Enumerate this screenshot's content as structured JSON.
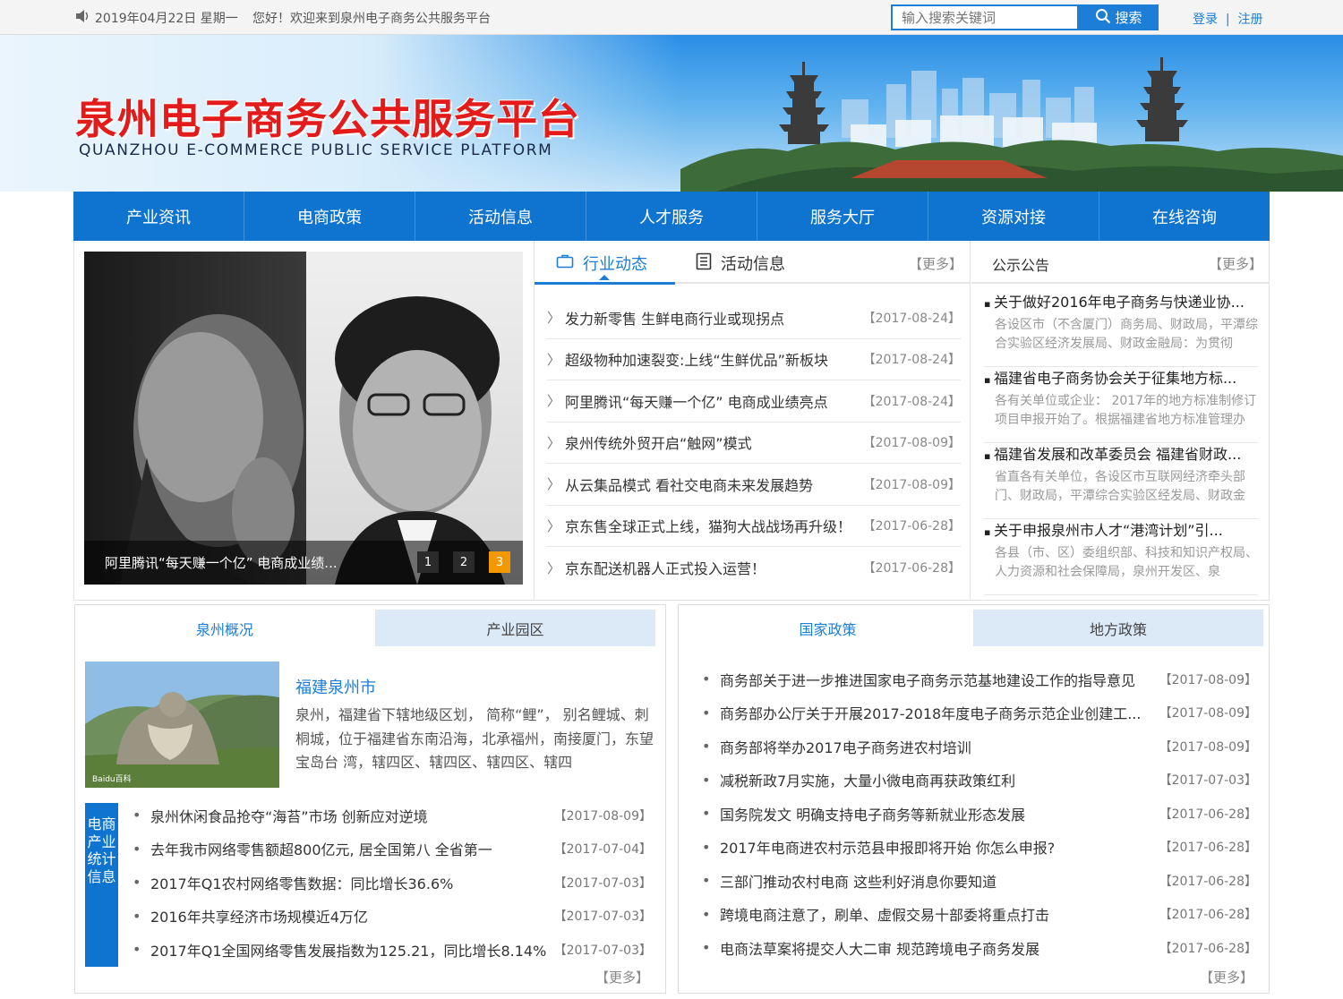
{
  "topbar": {
    "date": "2019年04月22日 星期一",
    "welcome": "您好！欢迎来到泉州电子商务公共服务平台",
    "search_placeholder": "输入搜索关键词",
    "search_label": "搜索",
    "login": "登录",
    "sep": "|",
    "register": "注册"
  },
  "banner": {
    "title": "泉州电子商务公共服务平台",
    "subtitle": "QUANZHOU E-COMMERCE PUBLIC SERVICE PLATFORM"
  },
  "nav": [
    "产业资讯",
    "电商政策",
    "活动信息",
    "人才服务",
    "服务大厅",
    "资源对接",
    "在线咨询"
  ],
  "slider": {
    "caption": "阿里腾讯“每天赚一个亿” 电商成业绩...",
    "pages": [
      "1",
      "2",
      "3"
    ],
    "active_page": 3
  },
  "news": {
    "tab_active": "行业动态",
    "tab_other": "活动信息",
    "more": "【更多】",
    "items": [
      {
        "title": "发力新零售 生鲜电商行业或现拐点",
        "date": "【2017-08-24】"
      },
      {
        "title": "超级物种加速裂变:上线“生鲜优品”新板块",
        "date": "【2017-08-24】"
      },
      {
        "title": "阿里腾讯“每天赚一个亿” 电商成业绩亮点",
        "date": "【2017-08-24】"
      },
      {
        "title": "泉州传统外贸开启“触网”模式",
        "date": "【2017-08-09】"
      },
      {
        "title": "从云集品模式 看社交电商未来发展趋势",
        "date": "【2017-08-09】"
      },
      {
        "title": "京东售全球正式上线，猫狗大战战场再升级！",
        "date": "【2017-06-28】"
      },
      {
        "title": "京东配送机器人正式投入运营！",
        "date": "【2017-06-28】"
      }
    ]
  },
  "notices": {
    "title": "公示公告",
    "more": "【更多】",
    "items": [
      {
        "title": "关于做好2016年电子商务与快递业协...",
        "desc": "各设区市（不含厦门）商务局、财政局，平潭综合实验区经济发展局、财政金融局：为贯彻"
      },
      {
        "title": "福建省电子商务协会关于征集地方标...",
        "desc": "各有关单位或企业： 2017年的地方标准制修订项目申报开始了。根据福建省地方标准管理办"
      },
      {
        "title": "福建省发展和改革委员会 福建省财政...",
        "desc": "省直各有关单位，各设区市互联网经济牵头部门、财政局，平潭综合实验区经发局、财政金"
      },
      {
        "title": "关于申报泉州市人才“港湾计划”引...",
        "desc": "各县（市、区）委组织部、科技和知识产权局、人力资源和社会保障局，泉州开发区、泉"
      }
    ]
  },
  "overview": {
    "tab_active": "泉州概况",
    "tab_other": "产业园区",
    "city_title": "福建泉州市",
    "city_desc": "泉州，福建省下辖地级区划， 简称“鲤”， 别名鲤城、刺桐城，位于福建省东南沿海，北承福州，南接厦门，东望宝岛台 湾，辖四区、辖四区、辖四区、辖四",
    "image_watermark": "Baidu百科",
    "stat_tag": "电商产业统计信息",
    "more": "【更多】",
    "stats": [
      {
        "title": "泉州休闲食品抢夺“海苔”市场 创新应对逆境",
        "date": "【2017-08-09】"
      },
      {
        "title": "去年我市网络零售额超800亿元, 居全国第八 全省第一",
        "date": "【2017-07-04】"
      },
      {
        "title": "2017年Q1农村网络零售数据：同比增长36.6%",
        "date": "【2017-07-03】"
      },
      {
        "title": "2016年共享经济市场规模近4万亿",
        "date": "【2017-07-03】"
      },
      {
        "title": "2017年Q1全国网络零售发展指数为125.21，同比增长8.14%",
        "date": "【2017-07-03】"
      }
    ]
  },
  "policy": {
    "tab_active": "国家政策",
    "tab_other": "地方政策",
    "more": "【更多】",
    "items": [
      {
        "title": "商务部关于进一步推进国家电子商务示范基地建设工作的指导意见",
        "date": "【2017-08-09】"
      },
      {
        "title": "商务部办公厅关于开展2017-2018年度电子商务示范企业创建工...",
        "date": "【2017-08-09】"
      },
      {
        "title": "商务部将举办2017电子商务进农村培训",
        "date": "【2017-08-09】"
      },
      {
        "title": "减税新政7月实施，大量小微电商再获政策红利",
        "date": "【2017-07-03】"
      },
      {
        "title": "国务院发文 明确支持电子商务等新就业形态发展",
        "date": "【2017-06-28】"
      },
      {
        "title": "2017年电商进农村示范县申报即将开始 你怎么申报?",
        "date": "【2017-06-28】"
      },
      {
        "title": "三部门推动农村电商 这些利好消息你要知道",
        "date": "【2017-06-28】"
      },
      {
        "title": "跨境电商注意了，刷单、虚假交易十部委将重点打击",
        "date": "【2017-06-28】"
      },
      {
        "title": "电商法草案将提交人大二审 规范跨境电子商务发展",
        "date": "【2017-06-28】"
      }
    ]
  },
  "colors": {
    "primary": "#0f74cf",
    "link": "#1c7ed6",
    "title_red": "#e31b1b",
    "active_dot": "#f39800"
  }
}
